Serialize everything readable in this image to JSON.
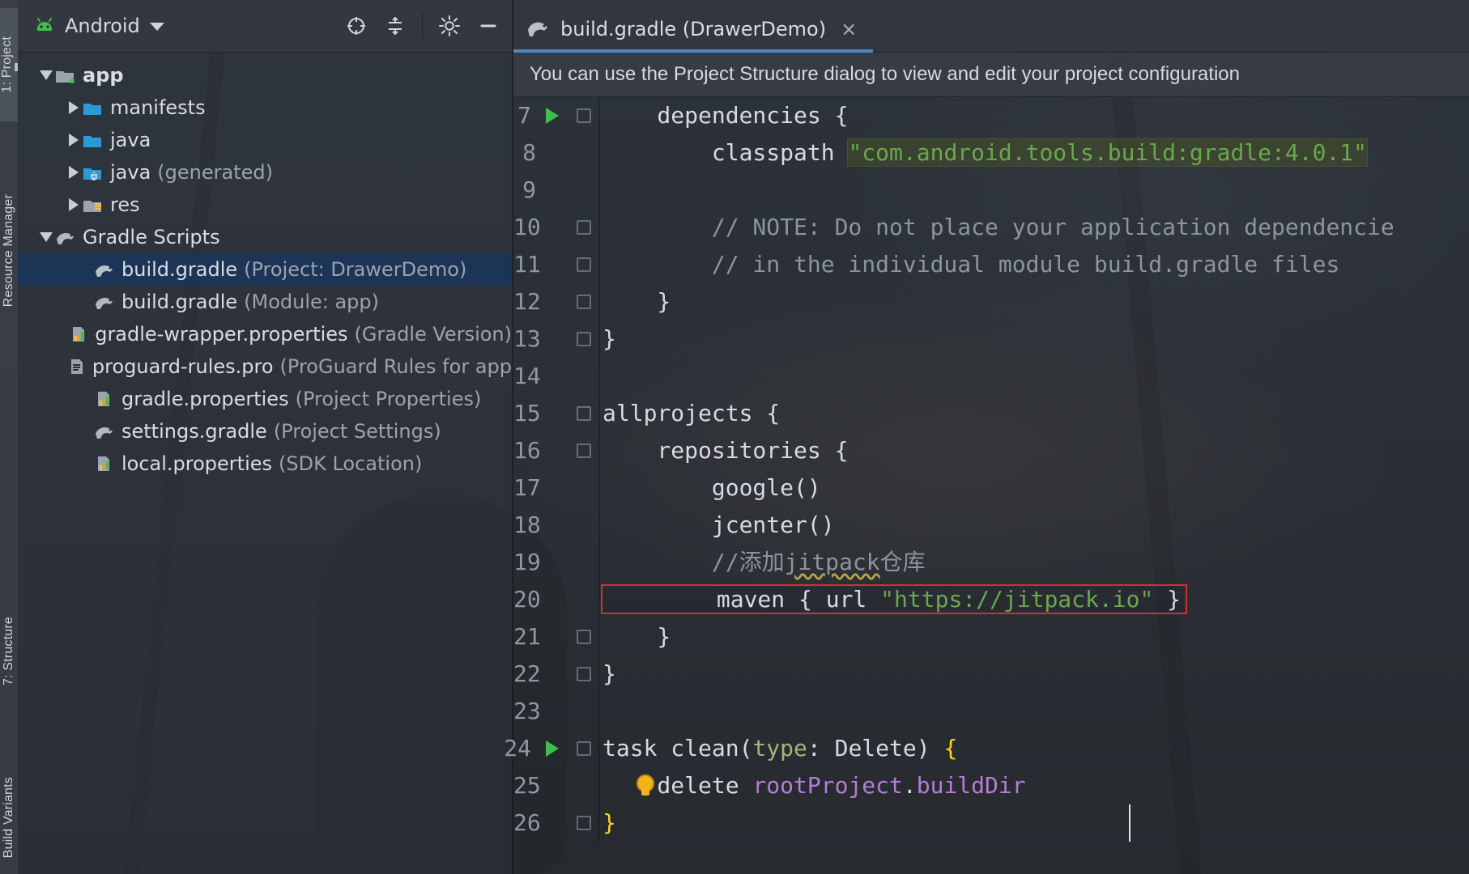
{
  "theme": {
    "accent_blue": "#4a88c7",
    "selection_bg": "#1b3556",
    "run_green": "#3fbf4a",
    "highlight_red": "#d32f2f",
    "string_green": "#6aa84f",
    "comment_gray": "#8c949e",
    "property_purple": "#b47dd6",
    "brace_yellow": "#ffd21f"
  },
  "left_strip": {
    "project_tab": "1: Project",
    "resource_manager_tab": "Resource Manager",
    "structure_tab": "7: Structure",
    "build_variants_tab": "Build Variants"
  },
  "project_panel": {
    "view_label": "Android",
    "toolbar": {
      "locate_icon": "crosshair-icon",
      "collapse_icon": "collapse-all-icon",
      "settings_icon": "gear-icon",
      "hide_icon": "minus-icon"
    },
    "tree": [
      {
        "level": 0,
        "expanded": true,
        "icon": "module-folder-icon",
        "name": "app",
        "hint": "",
        "bold": true
      },
      {
        "level": 1,
        "expanded": false,
        "icon": "folder-icon",
        "name": "manifests",
        "hint": ""
      },
      {
        "level": 1,
        "expanded": false,
        "icon": "folder-icon",
        "name": "java",
        "hint": ""
      },
      {
        "level": 1,
        "expanded": false,
        "icon": "generated-folder-icon",
        "name": "java",
        "hint": "(generated)"
      },
      {
        "level": 1,
        "expanded": false,
        "icon": "resources-folder-icon",
        "name": "res",
        "hint": ""
      },
      {
        "level": 0,
        "expanded": true,
        "icon": "gradle-icon",
        "name": "Gradle Scripts",
        "hint": ""
      },
      {
        "level": 2,
        "expanded": null,
        "icon": "gradle-file-icon",
        "name": "build.gradle",
        "hint": "(Project: DrawerDemo)",
        "selected": true
      },
      {
        "level": 2,
        "expanded": null,
        "icon": "gradle-file-icon",
        "name": "build.gradle",
        "hint": "(Module: app)"
      },
      {
        "level": 2,
        "expanded": null,
        "icon": "properties-file-icon",
        "name": "gradle-wrapper.properties",
        "hint": "(Gradle Version)"
      },
      {
        "level": 2,
        "expanded": null,
        "icon": "text-file-icon",
        "name": "proguard-rules.pro",
        "hint": "(ProGuard Rules for app"
      },
      {
        "level": 2,
        "expanded": null,
        "icon": "properties-file-icon",
        "name": "gradle.properties",
        "hint": "(Project Properties)"
      },
      {
        "level": 2,
        "expanded": null,
        "icon": "gradle-file-icon",
        "name": "settings.gradle",
        "hint": "(Project Settings)"
      },
      {
        "level": 2,
        "expanded": null,
        "icon": "properties-file-icon",
        "name": "local.properties",
        "hint": "(SDK Location)"
      }
    ]
  },
  "editor": {
    "tab": {
      "title": "build.gradle (DrawerDemo)",
      "close": "×",
      "icon": "gradle-file-icon"
    },
    "notice": "You can use the Project Structure dialog to view and edit your project configuration",
    "lines": [
      {
        "n": "7",
        "run": true,
        "fold": true,
        "parts": [
          {
            "t": "    dependencies {",
            "c": ""
          }
        ]
      },
      {
        "n": "8",
        "run": false,
        "fold": false,
        "parts": [
          {
            "t": "        classpath ",
            "c": ""
          },
          {
            "t": "\"com.android.tools.build:gradle:4.0.1\"",
            "c": "str strbg"
          }
        ]
      },
      {
        "n": "9",
        "run": false,
        "fold": false,
        "parts": [
          {
            "t": "",
            "c": ""
          }
        ]
      },
      {
        "n": "10",
        "run": false,
        "fold": true,
        "parts": [
          {
            "t": "        // NOTE: Do not place your application dependencie",
            "c": "comment"
          }
        ]
      },
      {
        "n": "11",
        "run": false,
        "fold": true,
        "parts": [
          {
            "t": "        // in the individual module build.gradle files",
            "c": "comment"
          }
        ]
      },
      {
        "n": "12",
        "run": false,
        "fold": true,
        "parts": [
          {
            "t": "    }",
            "c": ""
          }
        ]
      },
      {
        "n": "13",
        "run": false,
        "fold": true,
        "parts": [
          {
            "t": "}",
            "c": ""
          }
        ]
      },
      {
        "n": "14",
        "run": false,
        "fold": false,
        "parts": [
          {
            "t": "",
            "c": ""
          }
        ]
      },
      {
        "n": "15",
        "run": false,
        "fold": true,
        "parts": [
          {
            "t": "allprojects {",
            "c": ""
          }
        ]
      },
      {
        "n": "16",
        "run": false,
        "fold": true,
        "parts": [
          {
            "t": "    repositories {",
            "c": ""
          }
        ]
      },
      {
        "n": "17",
        "run": false,
        "fold": false,
        "parts": [
          {
            "t": "        google()",
            "c": ""
          }
        ]
      },
      {
        "n": "18",
        "run": false,
        "fold": false,
        "parts": [
          {
            "t": "        jcenter()",
            "c": ""
          }
        ]
      },
      {
        "n": "19",
        "run": false,
        "fold": false,
        "parts": [
          {
            "t": "        //添加",
            "c": "comment"
          },
          {
            "t": "jitpack",
            "c": "comment squiggle"
          },
          {
            "t": "仓库",
            "c": "comment"
          }
        ]
      },
      {
        "n": "20",
        "run": false,
        "fold": false,
        "highlight": true,
        "parts": [
          {
            "t": "        maven { url ",
            "c": ""
          },
          {
            "t": "\"https://jitpack.io\"",
            "c": "str"
          },
          {
            "t": " }",
            "c": ""
          }
        ]
      },
      {
        "n": "21",
        "run": false,
        "fold": true,
        "parts": [
          {
            "t": "    }",
            "c": ""
          }
        ]
      },
      {
        "n": "22",
        "run": false,
        "fold": true,
        "parts": [
          {
            "t": "}",
            "c": ""
          }
        ]
      },
      {
        "n": "23",
        "run": false,
        "fold": false,
        "parts": [
          {
            "t": "",
            "c": ""
          }
        ]
      },
      {
        "n": "24",
        "run": true,
        "fold": true,
        "parts": [
          {
            "t": "task clean(",
            "c": ""
          },
          {
            "t": "type",
            "c": "param"
          },
          {
            "t": ": Delete) ",
            "c": ""
          },
          {
            "t": "{",
            "c": "brace-hi"
          }
        ]
      },
      {
        "n": "25",
        "run": false,
        "fold": false,
        "bulb": true,
        "parts": [
          {
            "t": "    delete ",
            "c": ""
          },
          {
            "t": "rootProject",
            "c": "prop"
          },
          {
            "t": ".",
            "c": ""
          },
          {
            "t": "buildDir",
            "c": "prop"
          }
        ]
      },
      {
        "n": "26",
        "run": false,
        "fold": true,
        "caret": true,
        "parts": [
          {
            "t": "}",
            "c": "brace-hi"
          }
        ]
      }
    ]
  }
}
